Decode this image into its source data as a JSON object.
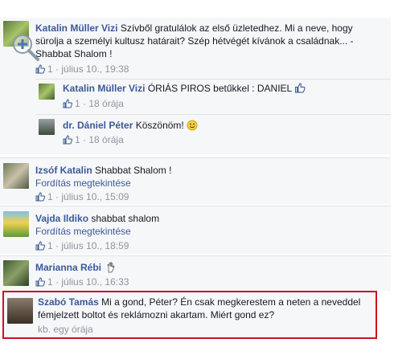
{
  "comments": [
    {
      "author": "Katalin Müller Vizi",
      "text_l1": "Szívből gratulálok az első üzletedhez. Mi a neve, hogy",
      "text_l2": "sürolja a személyi kultusz határait? Szép hétvégét kívánok a családnak... -",
      "text_l3": "Shabbat Shalom !",
      "likes": "1",
      "time": "július 10., 19:38"
    },
    {
      "author": "Izsóf Katalin",
      "text": "Shabbat Shalom !",
      "translate": "Fordítás megtekintése",
      "likes": "1",
      "time": "július 10., 15:09"
    },
    {
      "author": "Vajda Ildiko",
      "text": "shabbat shalom",
      "translate": "Fordítás megtekintése",
      "likes": "1",
      "time": "július 10., 18:59"
    },
    {
      "author": "Marianna Rébi",
      "likes": "1",
      "time": "július 10., 16:33"
    },
    {
      "author": "Szabó Tamás",
      "text_l1": "Mi a gond, Péter? Én csak megkerestem a neten a neveddel",
      "text_l2": "fémjelzett boltot és reklámozni akartam. Miért gond ez?",
      "time": "kb. egy órája"
    }
  ],
  "replies": [
    {
      "author": "Katalin Müller Vizi",
      "text": "ÓRIÁS PIROS betűkkel : DANIEL",
      "likes": "1",
      "time": "18 órája"
    },
    {
      "author": "dr. Dániel Péter",
      "text": "Köszönöm!",
      "likes": "1",
      "time": "18 órája"
    }
  ],
  "separator": "·",
  "colors": {
    "link": "#3b5998",
    "meta": "#90949c",
    "highlight": "#c9161d",
    "bg": "#f6f7f9"
  },
  "icons": [
    "like-icon",
    "thumbs-up-icon",
    "smiley-icon",
    "hand-icon",
    "zoom-icon"
  ]
}
